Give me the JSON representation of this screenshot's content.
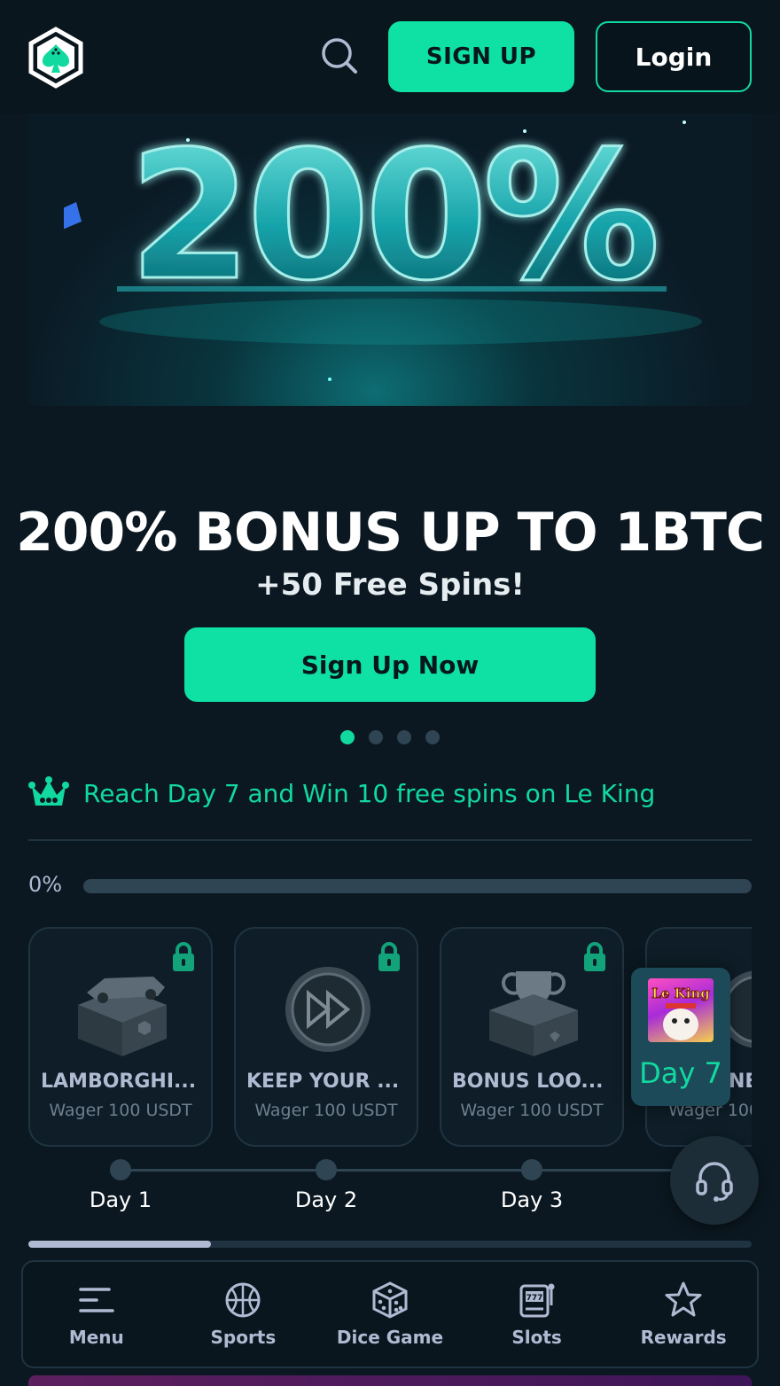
{
  "header": {
    "signup_label": "SIGN UP",
    "login_label": "Login"
  },
  "hero": {
    "banner_text": "200%",
    "title": "200% BONUS UP TO 1BTC",
    "subtitle": "+50 Free Spins!",
    "cta_label": "Sign Up Now",
    "slides_count": 4,
    "active_slide": 1
  },
  "challenge": {
    "text": "Reach Day 7 and Win 10 free spins on Le King",
    "progress_label": "0%",
    "progress_value": 0
  },
  "rewards": [
    {
      "title": "LAMBORGHI...",
      "subtitle": "Wager 100 USDT",
      "locked": true
    },
    {
      "title": "KEEP YOUR ...",
      "subtitle": "Wager 100 USDT",
      "locked": true
    },
    {
      "title": "BONUS LOO...",
      "subtitle": "Wager 100 USDT",
      "locked": true
    },
    {
      "title": "NE",
      "subtitle": "Wager 100",
      "locked": true
    }
  ],
  "day7": {
    "label": "Day 7",
    "game_logo_text": "Le King"
  },
  "timeline": [
    "Day 1",
    "Day 2",
    "Day 3"
  ],
  "nav": [
    {
      "label": "Menu",
      "icon": "menu-icon"
    },
    {
      "label": "Sports",
      "icon": "basketball-icon"
    },
    {
      "label": "Dice Game",
      "icon": "dice-icon"
    },
    {
      "label": "Slots",
      "icon": "slot-machine-icon"
    },
    {
      "label": "Rewards",
      "icon": "star-icon"
    }
  ],
  "colors": {
    "accent": "#12d9a0",
    "background": "#0b1821",
    "muted": "#b1bad3"
  }
}
